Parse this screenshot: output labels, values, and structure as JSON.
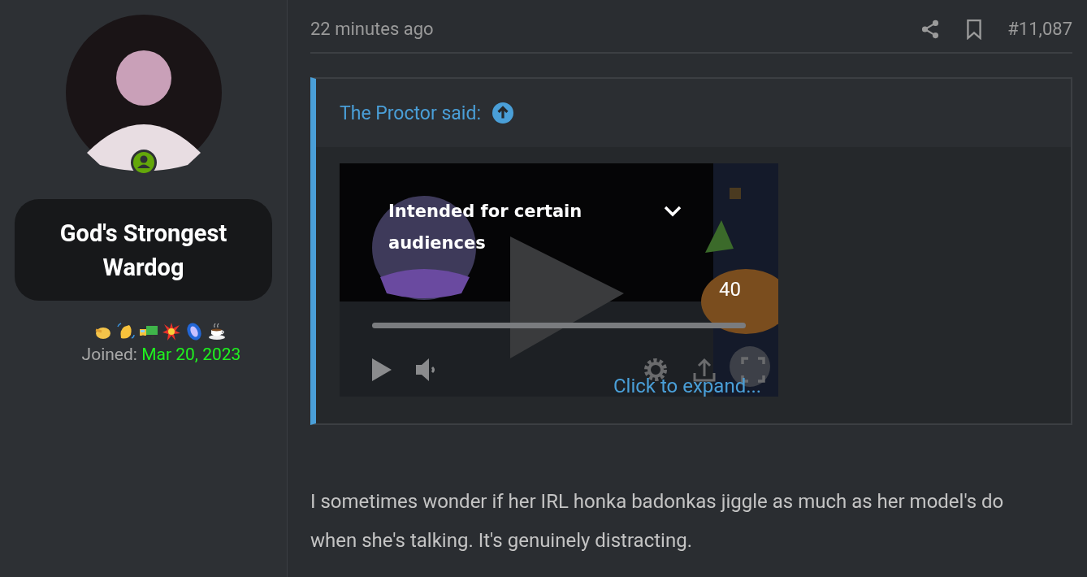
{
  "user": {
    "name": "God's Strongest Wardog",
    "online": true,
    "joined_label": "Joined:",
    "joined_date": "Mar 20, 2023"
  },
  "post": {
    "time": "22 minutes ago",
    "number": "#11,087",
    "quote": {
      "author": "The Proctor said:",
      "embed": {
        "kind": "picture",
        "notice": "Intended for certain audiences",
        "count": "40"
      },
      "expand": "Click to expand..."
    },
    "body": "I sometimes wonder if her IRL honka badonkas jiggle as much as her model's do when she's talking. It's genuinely distracting."
  }
}
